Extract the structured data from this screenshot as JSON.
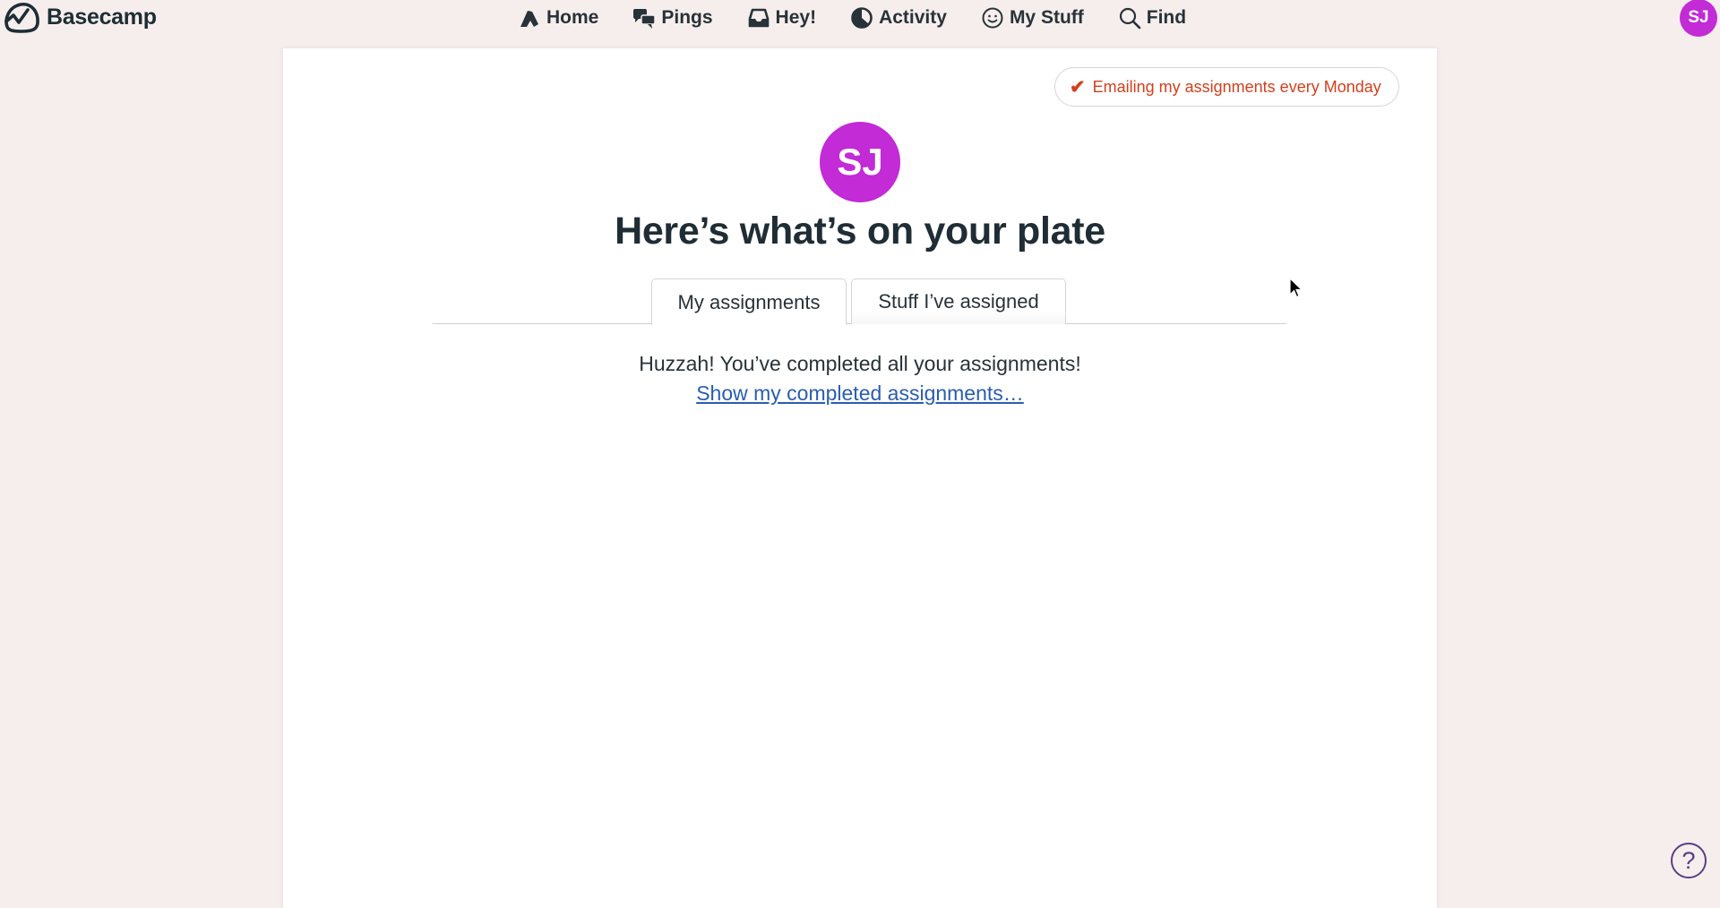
{
  "app": {
    "name": "Basecamp"
  },
  "nav": {
    "items": [
      {
        "label": "Home",
        "icon": "home-icon"
      },
      {
        "label": "Pings",
        "icon": "pings-icon"
      },
      {
        "label": "Hey!",
        "icon": "inbox-icon"
      },
      {
        "label": "Activity",
        "icon": "activity-icon"
      },
      {
        "label": "My Stuff",
        "icon": "smiley-icon"
      },
      {
        "label": "Find",
        "icon": "search-icon"
      }
    ]
  },
  "user": {
    "initials": "SJ",
    "avatar_color": "#c22bd6"
  },
  "email_badge": {
    "check": "✔",
    "label": "Emailing my assignments every Monday",
    "color": "#d2401d"
  },
  "page": {
    "title": "Here’s what’s on your plate",
    "tabs": [
      {
        "label": "My assignments",
        "active": true
      },
      {
        "label": "Stuff I’ve assigned",
        "active": false
      }
    ],
    "empty_message": "Huzzah! You’ve completed all your assignments!",
    "completed_link": "Show my completed assignments…"
  },
  "help": {
    "label": "?"
  }
}
